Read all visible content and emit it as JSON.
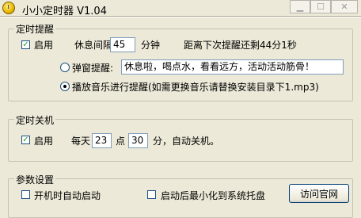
{
  "window": {
    "title": "小小定时器 V1.04"
  },
  "reminder": {
    "group_title": "定时提醒",
    "enable_label": "启用",
    "enabled": true,
    "interval_label": "休息间隔",
    "interval_value": "45",
    "interval_unit": "分钟",
    "countdown_text": "距离下次提醒还剩44分1秒",
    "popup_label": "弹窗提醒:",
    "popup_message": "休息啦，喝点水，看看远方，活动活动筋骨！",
    "music_label": "播放音乐进行提醒(如需更换音乐请替换安装目录下1.mp3)",
    "selected_mode": "music"
  },
  "shutdown": {
    "group_title": "定时关机",
    "enable_label": "启用",
    "enabled": true,
    "daily_label": "每天",
    "hour_value": "23",
    "hour_unit": "点",
    "minute_value": "30",
    "minute_suffix": "分，自动关机。"
  },
  "settings": {
    "group_title": "参数设置",
    "autostart_label": "开机时自动启动",
    "autostart_checked": false,
    "minimize_label": "启动后最小化到系统托盘",
    "minimize_checked": false,
    "website_button": "访问官网"
  }
}
